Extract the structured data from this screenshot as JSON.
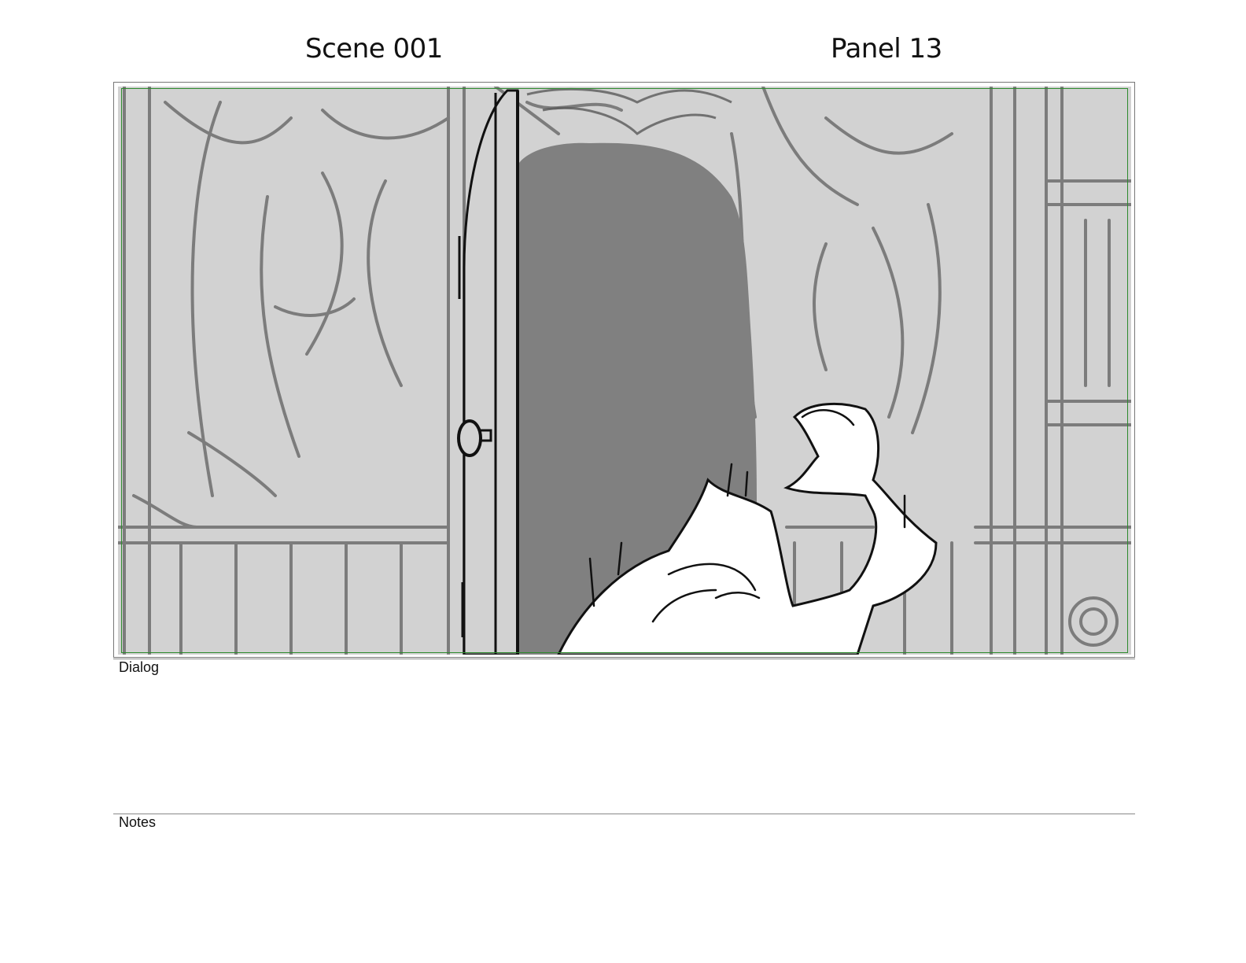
{
  "header": {
    "scene_label": "Scene 001",
    "panel_label": "Panel 13"
  },
  "panel_image": {
    "icon": "storyboard-sketch-door-figure",
    "background_color": "#d2d2d2",
    "doorway_color": "#808080",
    "safe_area_color": "#2e8b2e"
  },
  "dialog": {
    "label": "Dialog",
    "text": ""
  },
  "notes": {
    "label": "Notes",
    "text": ""
  }
}
